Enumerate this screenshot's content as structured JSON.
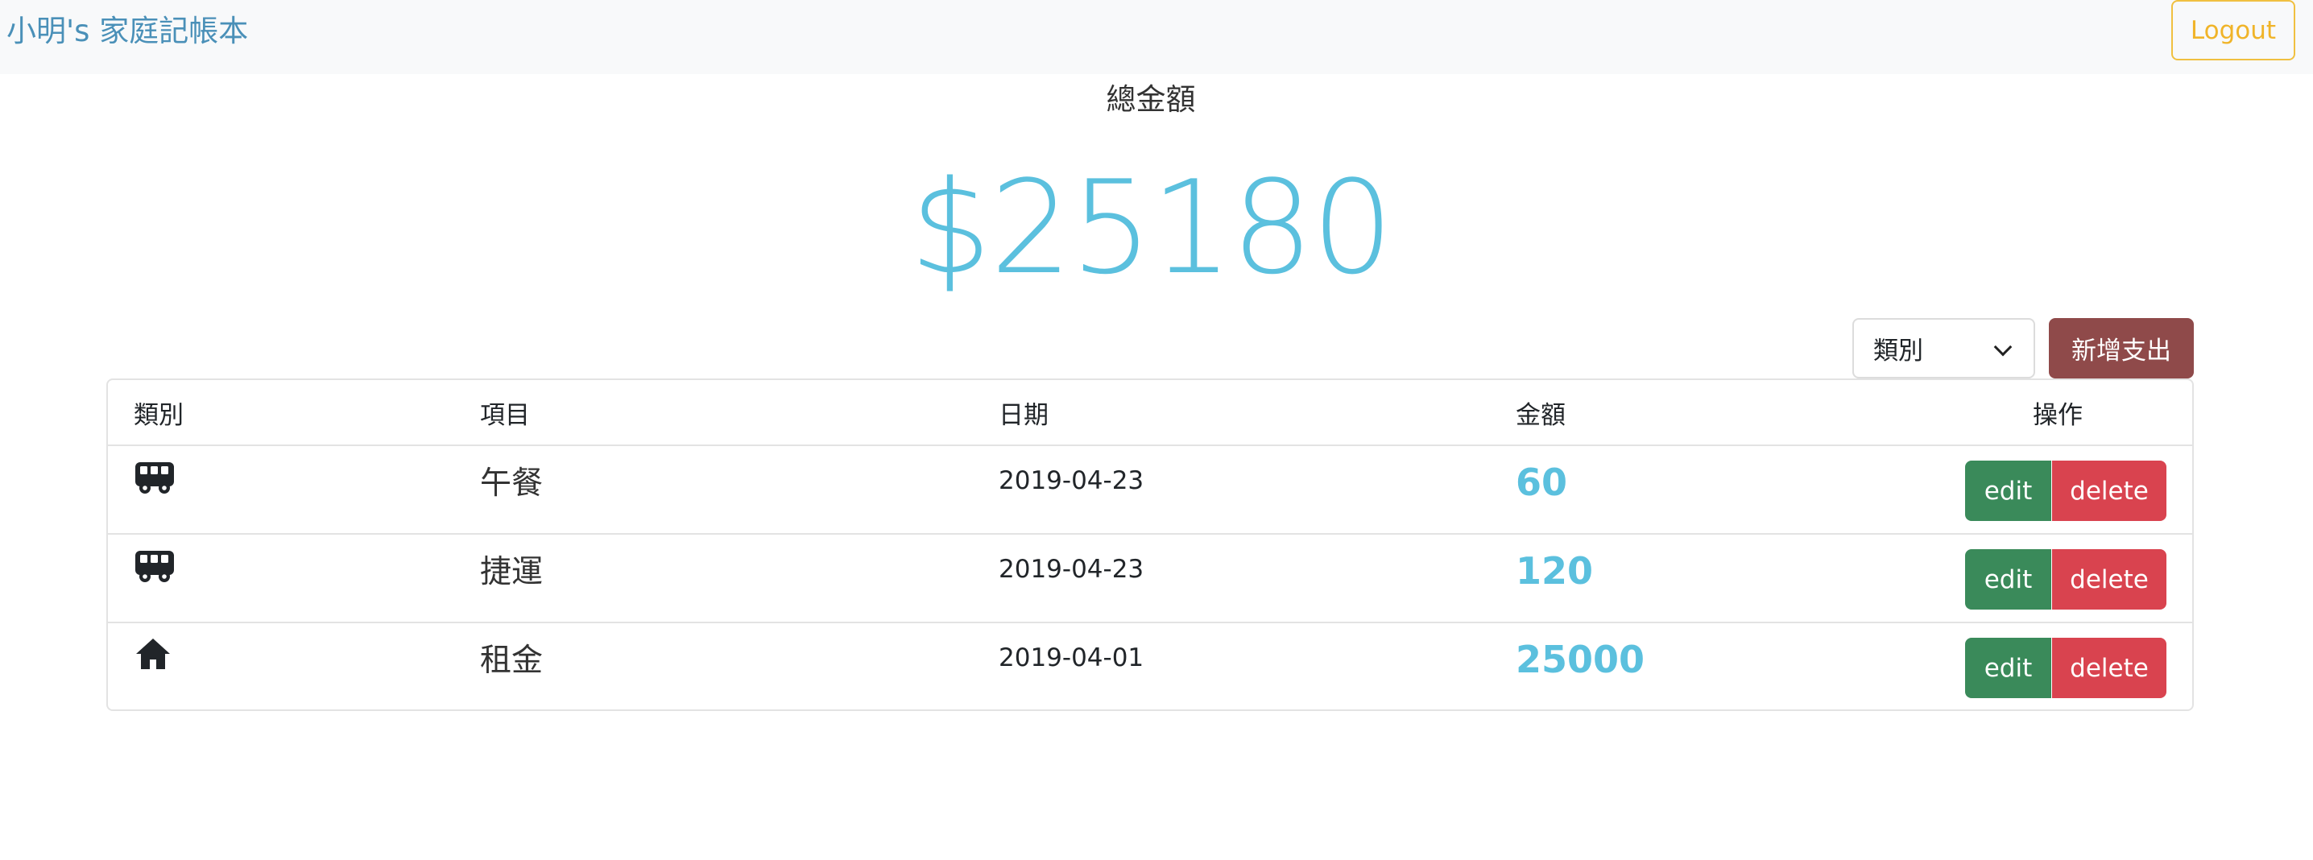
{
  "header": {
    "brand": "小明's 家庭記帳本",
    "logout_label": "Logout"
  },
  "summary": {
    "label": "總金額",
    "amount": "$25180"
  },
  "controls": {
    "category_select_value": "類別",
    "add_button_label": "新增支出"
  },
  "table": {
    "headers": {
      "category": "類別",
      "item": "項目",
      "date": "日期",
      "amount": "金額",
      "actions": "操作"
    },
    "rows": [
      {
        "category_icon": "bus-icon",
        "item": "午餐",
        "date": "2019-04-23",
        "amount": "60",
        "edit_label": "edit",
        "delete_label": "delete"
      },
      {
        "category_icon": "bus-icon",
        "item": "捷運",
        "date": "2019-04-23",
        "amount": "120",
        "edit_label": "edit",
        "delete_label": "delete"
      },
      {
        "category_icon": "home-icon",
        "item": "租金",
        "date": "2019-04-01",
        "amount": "25000",
        "edit_label": "edit",
        "delete_label": "delete"
      }
    ]
  },
  "colors": {
    "brand": "#4a90b8",
    "accent_amount": "#5bc0de",
    "logout_border": "#f0c040",
    "add_button": "#8f4a4a",
    "edit_button": "#3a8a5a",
    "delete_button": "#d9434f"
  }
}
